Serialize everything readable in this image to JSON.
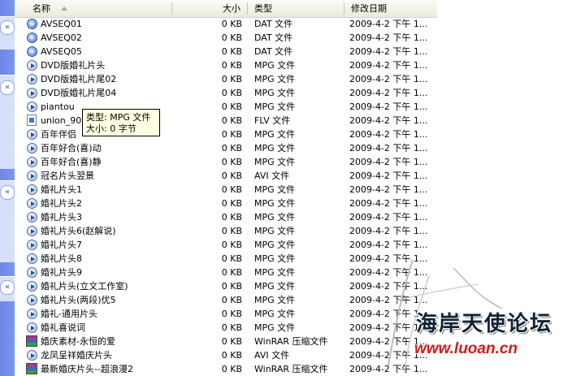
{
  "columns": {
    "name": "名称",
    "size": "大小",
    "type": "类型",
    "modified": "修改日期"
  },
  "files": [
    {
      "name": "AVSEQ01",
      "size": "0 KB",
      "type": "DAT 文件",
      "modified": "2009-4-2  下午 1...",
      "icon": "dat-icon"
    },
    {
      "name": "AVSEQ02",
      "size": "0 KB",
      "type": "DAT 文件",
      "modified": "2009-4-2  下午 1...",
      "icon": "dat-icon"
    },
    {
      "name": "AVSEQ05",
      "size": "0 KB",
      "type": "DAT 文件",
      "modified": "2009-4-2  下午 1...",
      "icon": "dat-icon"
    },
    {
      "name": "DVD版婚礼片头",
      "size": "0 KB",
      "type": "MPG 文件",
      "modified": "2009-4-2  下午 1...",
      "icon": "media-icon"
    },
    {
      "name": "DVD版婚礼片尾02",
      "size": "0 KB",
      "type": "MPG 文件",
      "modified": "2009-4-2  下午 1...",
      "icon": "media-icon"
    },
    {
      "name": "DVD版婚礼片尾04",
      "size": "0 KB",
      "type": "MPG 文件",
      "modified": "2009-4-2  下午 1...",
      "icon": "media-icon"
    },
    {
      "name": "piantou",
      "size": "0 KB",
      "type": "MPG 文件",
      "modified": "2009-4-2  下午 1...",
      "icon": "media-icon"
    },
    {
      "name": "union_90",
      "size": "0 KB",
      "type": "FLV 文件",
      "modified": "2009-4-2  下午 1...",
      "icon": "flv-icon"
    },
    {
      "name": "百年伴侣",
      "size": "0 KB",
      "type": "MPG 文件",
      "modified": "2009-4-2  下午 1...",
      "icon": "media-icon"
    },
    {
      "name": "百年好合(喜)动",
      "size": "0 KB",
      "type": "MPG 文件",
      "modified": "2009-4-2  下午 1...",
      "icon": "media-icon"
    },
    {
      "name": "百年好合(喜)静",
      "size": "0 KB",
      "type": "MPG 文件",
      "modified": "2009-4-2  下午 1...",
      "icon": "media-icon"
    },
    {
      "name": "冠名片头翌景",
      "size": "0 KB",
      "type": "AVI 文件",
      "modified": "2009-4-2  下午 1...",
      "icon": "media-icon"
    },
    {
      "name": "婚礼片头1",
      "size": "0 KB",
      "type": "MPG 文件",
      "modified": "2009-4-2  下午 1...",
      "icon": "media-icon"
    },
    {
      "name": "婚礼片头2",
      "size": "0 KB",
      "type": "MPG 文件",
      "modified": "2009-4-2  下午 1...",
      "icon": "media-icon"
    },
    {
      "name": "婚礼片头3",
      "size": "0 KB",
      "type": "MPG 文件",
      "modified": "2009-4-2  下午 1...",
      "icon": "media-icon"
    },
    {
      "name": "婚礼片头6(赵解说)",
      "size": "0 KB",
      "type": "MPG 文件",
      "modified": "2009-4-2  下午 1...",
      "icon": "media-icon"
    },
    {
      "name": "婚礼片头7",
      "size": "0 KB",
      "type": "MPG 文件",
      "modified": "2009-4-2  下午 1...",
      "icon": "media-icon"
    },
    {
      "name": "婚礼片头8",
      "size": "0 KB",
      "type": "MPG 文件",
      "modified": "2009-4-2  下午 1...",
      "icon": "media-icon"
    },
    {
      "name": "婚礼片头9",
      "size": "0 KB",
      "type": "MPG 文件",
      "modified": "2009-4-2  下午 1...",
      "icon": "media-icon"
    },
    {
      "name": "婚礼片头(立文工作室)",
      "size": "0 KB",
      "type": "MPG 文件",
      "modified": "2009-4-2  下午 1...",
      "icon": "media-icon"
    },
    {
      "name": "婚礼片头(两段)优5",
      "size": "0 KB",
      "type": "MPG 文件",
      "modified": "2009-4-2  下午 1...",
      "icon": "media-icon"
    },
    {
      "name": "婚礼-通用片头",
      "size": "0 KB",
      "type": "MPG 文件",
      "modified": "2009-4-2  下午 1...",
      "icon": "media-icon"
    },
    {
      "name": "婚礼喜说词",
      "size": "0 KB",
      "type": "MPG 文件",
      "modified": "2009-4-2  下午 1...",
      "icon": "media-icon"
    },
    {
      "name": "婚庆素材-永恒的爱",
      "size": "0 KB",
      "type": "WinRAR 压缩文件",
      "modified": "2009-4-2  下午 1...",
      "icon": "rar-icon"
    },
    {
      "name": "龙凤呈祥婚庆片头",
      "size": "0 KB",
      "type": "AVI 文件",
      "modified": "2009-4-2  下午 1...",
      "icon": "media-icon"
    },
    {
      "name": "最新婚庆片头--超浪漫2",
      "size": "0 KB",
      "type": "WinRAR 压缩文件",
      "modified": "2009-4-2  下午 1...",
      "icon": "rar-icon"
    }
  ],
  "tooltip": {
    "type_line": "类型: MPG 文件",
    "size_line": "大小: 0 字节"
  },
  "watermark": {
    "title": "海岸天使论坛",
    "url": "www.luoan.cn"
  },
  "taskpane": {
    "chevron_glyph": "«"
  }
}
